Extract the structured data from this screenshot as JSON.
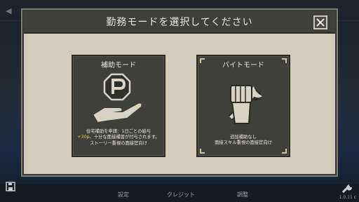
{
  "dialog": {
    "title": "勤務モードを選択してください",
    "close_icon": "close-icon"
  },
  "modes": [
    {
      "title": "補助モード",
      "icon": "parking-hand-icon",
      "desc_line1": "住宅補助を申請：1日ごとの給与",
      "desc_line2_highlight": "+30p",
      "desc_line2_rest": "、十分な面接補習が付与されます。",
      "desc_line3": "ストーリー重視の面接官向け"
    },
    {
      "title": "バイトモード",
      "icon": "fist-wrench-icon",
      "desc_line1": "追加補助なし",
      "desc_line2": "面接スキル重視の面接官向け",
      "selected": true
    }
  ],
  "background": {
    "menu_items": [
      "設定",
      "クレジット",
      "調整"
    ],
    "version": "1.0.11 c"
  },
  "colors": {
    "panel": "#d2ccba",
    "card": "#3f3f3b",
    "text": "#ece8dc",
    "highlight": "#e8d34a"
  }
}
